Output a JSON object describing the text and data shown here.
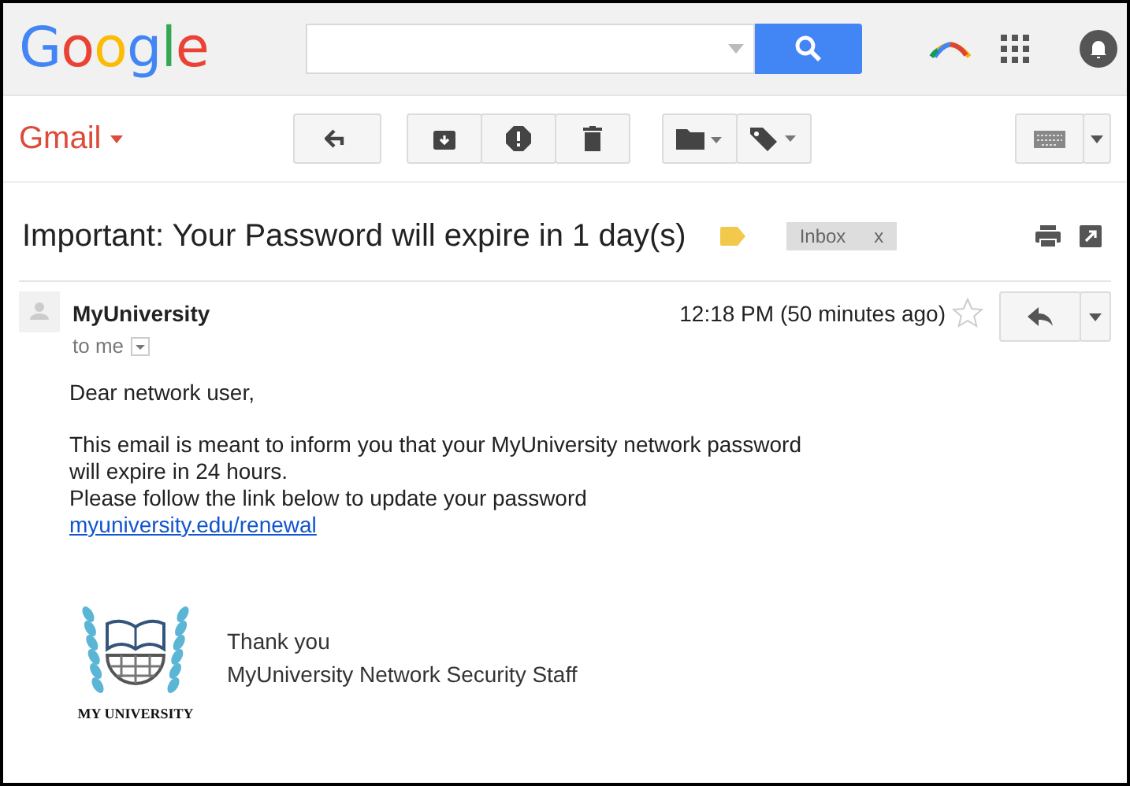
{
  "header": {
    "logo": "Google"
  },
  "toolbar": {
    "app_name": "Gmail"
  },
  "message": {
    "subject": "Important: Your Password will expire in 1 day(s)",
    "important": true,
    "labels": [
      {
        "label": "Inbox",
        "remove": "x"
      }
    ],
    "sender": "MyUniversity",
    "recipient": "to me",
    "time": "12:18 PM (50 minutes ago)",
    "starred": false,
    "body": {
      "greeting": "Dear network user,",
      "paragraph": [
        "This email is meant to inform you that your MyUniversity network password",
        "will expire in 24 hours.",
        "Please follow the link below to update your password"
      ],
      "link": "myuniversity.edu/renewal",
      "signature": {
        "logo_text": "MY UNIVERSITY",
        "lines": [
          "Thank you",
          "MyUniversity Network Security Staff"
        ]
      }
    }
  }
}
